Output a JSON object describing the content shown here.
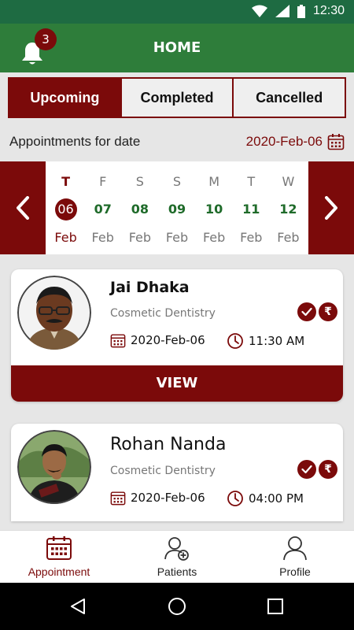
{
  "status_bar": {
    "time": "12:30"
  },
  "header": {
    "title": "HOME",
    "notification_count": "3"
  },
  "tabs": [
    {
      "label": "Upcoming",
      "active": true
    },
    {
      "label": "Completed",
      "active": false
    },
    {
      "label": "Cancelled",
      "active": false
    }
  ],
  "date_bar": {
    "label": "Appointments for date",
    "selected_date": "2020-Feb-06"
  },
  "week": [
    {
      "day": "T",
      "date": "06",
      "month": "Feb",
      "selected": true
    },
    {
      "day": "F",
      "date": "07",
      "month": "Feb"
    },
    {
      "day": "S",
      "date": "08",
      "month": "Feb"
    },
    {
      "day": "S",
      "date": "09",
      "month": "Feb"
    },
    {
      "day": "M",
      "date": "10",
      "month": "Feb"
    },
    {
      "day": "T",
      "date": "11",
      "month": "Feb"
    },
    {
      "day": "W",
      "date": "12",
      "month": "Feb"
    }
  ],
  "appointments": [
    {
      "name": "Jai Dhaka",
      "specialty": "Cosmetic Dentistry",
      "date": "2020-Feb-06",
      "time": "11:30 AM",
      "view_label": "VIEW"
    },
    {
      "name": "Rohan Nanda",
      "specialty": "Cosmetic Dentistry",
      "date": "2020-Feb-06",
      "time": "04:00 PM"
    }
  ],
  "payment_symbol": "₹",
  "bottom_nav": [
    {
      "label": "Appointment",
      "icon": "calendar-grid-icon",
      "active": true
    },
    {
      "label": "Patients",
      "icon": "add-user-icon"
    },
    {
      "label": "Profile",
      "icon": "user-icon"
    }
  ],
  "colors": {
    "primary": "#7b0a0a",
    "appbar": "#2e7d3a",
    "statusbar": "#1e6b42",
    "date_green": "#1f6b2a"
  }
}
